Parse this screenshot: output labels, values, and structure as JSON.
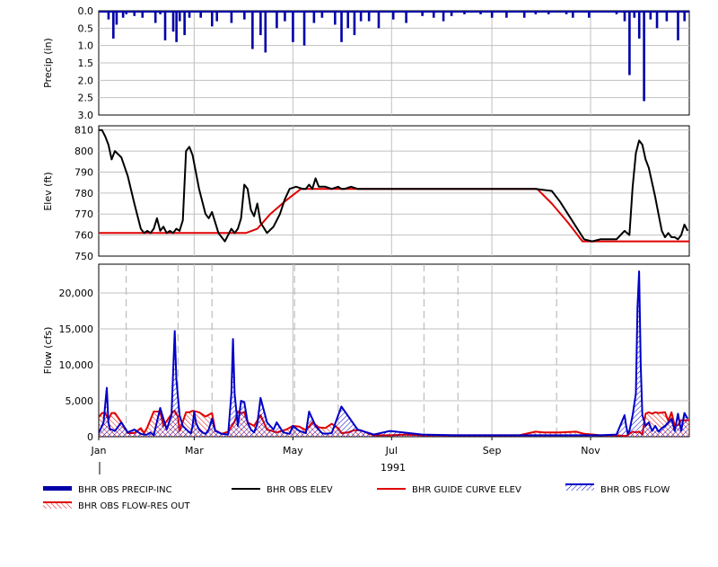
{
  "chart_data": [
    {
      "type": "bar",
      "panel": "precip",
      "series": [
        {
          "name": "BHR OBS PRECIP-INC",
          "color": "#0000a8"
        }
      ],
      "ylabel": "Precip (in)",
      "ylim": [
        0,
        3.0
      ],
      "y_inverted": true,
      "yticks": [
        "0.0",
        "0.5",
        "1.0",
        "1.5",
        "2.0",
        "2.5",
        "3.0"
      ],
      "grid": true,
      "day_of_year": [
        6,
        9,
        11,
        15,
        17,
        22,
        27,
        35,
        38,
        41,
        46,
        48,
        50,
        53,
        56,
        63,
        70,
        73,
        82,
        90,
        95,
        100,
        103,
        110,
        115,
        120,
        127,
        133,
        138,
        146,
        150,
        154,
        158,
        162,
        167,
        173,
        182,
        190,
        200,
        207,
        213,
        218,
        226,
        236,
        243,
        252,
        263,
        270,
        278,
        289,
        293,
        303,
        320,
        325,
        328,
        331,
        334,
        337,
        341,
        345,
        351,
        358,
        362
      ],
      "values": [
        0.25,
        0.8,
        0.4,
        0.2,
        0.1,
        0.15,
        0.2,
        0.35,
        0.1,
        0.85,
        0.6,
        0.9,
        0.3,
        0.7,
        0.2,
        0.2,
        0.45,
        0.3,
        0.35,
        0.25,
        1.1,
        0.7,
        1.2,
        0.5,
        0.3,
        0.9,
        1.0,
        0.35,
        0.2,
        0.4,
        0.9,
        0.5,
        0.7,
        0.3,
        0.3,
        0.5,
        0.25,
        0.35,
        0.15,
        0.2,
        0.3,
        0.15,
        0.1,
        0.1,
        0.2,
        0.2,
        0.2,
        0.1,
        0.1,
        0.1,
        0.2,
        0.2,
        0.1,
        0.3,
        1.85,
        0.2,
        0.8,
        2.6,
        0.25,
        0.5,
        0.3,
        0.85,
        0.3
      ],
      "dense_top": [
        0,
        365
      ]
    },
    {
      "type": "line",
      "panel": "elev",
      "ylabel": "Elev (ft)",
      "ylim": [
        750,
        812
      ],
      "yticks": [
        750,
        760,
        770,
        780,
        790,
        800,
        810
      ],
      "grid": true,
      "series": [
        {
          "name": "BHR OBS ELEV",
          "color": "#000000",
          "x": [
            0,
            2,
            4,
            6,
            8,
            10,
            14,
            18,
            22,
            26,
            28,
            30,
            32,
            34,
            36,
            38,
            40,
            42,
            44,
            46,
            48,
            50,
            52,
            54,
            56,
            58,
            60,
            62,
            64,
            66,
            68,
            70,
            72,
            74,
            76,
            78,
            80,
            82,
            84,
            86,
            88,
            90,
            92,
            94,
            96,
            98,
            100,
            104,
            108,
            112,
            115,
            118,
            122,
            126,
            128,
            130,
            132,
            134,
            136,
            140,
            144,
            148,
            150,
            152,
            156,
            160,
            170,
            180,
            200,
            220,
            240,
            260,
            270,
            280,
            285,
            290,
            295,
            300,
            305,
            310,
            315,
            320,
            325,
            328,
            330,
            332,
            334,
            336,
            338,
            340,
            342,
            344,
            346,
            348,
            350,
            352,
            354,
            356,
            358,
            360,
            362,
            364
          ],
          "y": [
            810,
            810,
            807,
            803,
            796,
            800,
            797,
            788,
            775,
            763,
            761,
            762,
            761,
            763,
            768,
            762,
            764,
            761,
            762,
            761,
            763,
            762,
            767,
            800,
            802,
            798,
            790,
            782,
            776,
            770,
            768,
            771,
            766,
            761,
            759,
            757,
            760,
            763,
            761,
            763,
            768,
            784,
            782,
            772,
            769,
            775,
            766,
            761,
            764,
            770,
            777,
            782,
            783,
            782,
            782,
            784,
            782,
            787,
            783,
            783,
            782,
            783,
            782,
            782,
            783,
            782,
            782,
            782,
            782,
            782,
            782,
            782,
            782,
            781,
            776,
            770,
            764,
            758,
            757,
            758,
            758,
            758,
            762,
            760,
            783,
            799,
            805,
            803,
            796,
            792,
            785,
            778,
            770,
            762,
            759,
            761,
            759,
            759,
            758,
            760,
            765,
            762
          ]
        },
        {
          "name": "BHR GUIDE CURVE ELEV",
          "color": "#e00000",
          "x": [
            0,
            91,
            98,
            106,
            115,
            125,
            150,
            200,
            250,
            271,
            280,
            290,
            299,
            365
          ],
          "y": [
            761,
            761,
            763,
            770,
            776,
            782,
            782,
            782,
            782,
            782,
            775,
            766,
            757,
            757
          ]
        }
      ]
    },
    {
      "type": "area",
      "panel": "flow",
      "ylabel": "Flow (cfs)",
      "ylim": [
        0,
        24000
      ],
      "yticks": [
        "0",
        "5,000",
        "10,000",
        "15,000",
        "20,000"
      ],
      "ytick_values": [
        0,
        5000,
        10000,
        15000,
        20000
      ],
      "grid": true,
      "x_ticks": [
        "Jan",
        "Mar",
        "May",
        "Jul",
        "Sep",
        "Nov"
      ],
      "x_tick_days": [
        0,
        59,
        120,
        181,
        243,
        304
      ],
      "x_sub_label": "1991",
      "series": [
        {
          "name": "BHR OBS FLOW",
          "color": "#0000c8",
          "x": [
            0,
            3,
            5,
            6,
            7,
            8,
            10,
            14,
            18,
            22,
            26,
            28,
            30,
            32,
            34,
            38,
            42,
            45,
            46,
            47,
            48,
            50,
            52,
            55,
            57,
            58,
            59,
            60,
            62,
            64,
            66,
            68,
            70,
            72,
            76,
            80,
            82,
            83,
            84,
            86,
            88,
            90,
            92,
            94,
            96,
            98,
            100,
            104,
            106,
            108,
            110,
            114,
            118,
            120,
            124,
            128,
            130,
            134,
            136,
            138,
            140,
            144,
            150,
            160,
            170,
            180,
            200,
            220,
            240,
            260,
            280,
            300,
            310,
            320,
            325,
            326,
            327,
            328,
            330,
            332,
            333,
            334,
            335,
            336,
            338,
            340,
            342,
            344,
            346,
            348,
            350,
            354,
            356,
            358,
            360,
            362,
            364
          ],
          "y": [
            500,
            2000,
            6800,
            2000,
            1000,
            1000,
            800,
            2000,
            600,
            1000,
            400,
            300,
            300,
            600,
            200,
            4000,
            1000,
            3000,
            9000,
            14700,
            8000,
            3000,
            1500,
            800,
            500,
            1500,
            3500,
            2000,
            1000,
            600,
            400,
            1000,
            2500,
            800,
            400,
            300,
            6000,
            13600,
            6000,
            1500,
            5000,
            4800,
            2000,
            1000,
            600,
            1800,
            5400,
            2000,
            1500,
            1000,
            2000,
            600,
            400,
            1500,
            800,
            500,
            3500,
            1500,
            1000,
            500,
            400,
            500,
            4200,
            1000,
            300,
            800,
            300,
            200,
            200,
            200,
            200,
            200,
            200,
            300,
            3000,
            1500,
            400,
            800,
            3000,
            6000,
            18000,
            23000,
            10000,
            3000,
            1500,
            2000,
            800,
            1500,
            700,
            1200,
            1500,
            2500,
            800,
            3200,
            800,
            3300,
            2500
          ]
        },
        {
          "name": "BHR OBS FLOW-RES OUT",
          "color": "#e00000",
          "x": [
            0,
            2,
            4,
            6,
            8,
            10,
            14,
            18,
            22,
            26,
            28,
            30,
            34,
            38,
            40,
            46,
            47,
            49,
            50,
            54,
            56,
            58,
            62,
            66,
            70,
            72,
            76,
            80,
            84,
            86,
            88,
            90,
            92,
            96,
            100,
            104,
            110,
            116,
            120,
            124,
            128,
            132,
            136,
            140,
            144,
            148,
            150,
            154,
            158,
            162,
            166,
            170,
            180,
            190,
            200,
            220,
            240,
            260,
            270,
            275,
            285,
            295,
            300,
            310,
            320,
            326,
            328,
            330,
            332,
            334,
            336,
            338,
            340,
            342,
            344,
            346,
            350,
            352,
            354,
            356,
            358,
            360,
            362,
            365
          ],
          "y": [
            2700,
            3300,
            3300,
            2400,
            3300,
            3300,
            2000,
            500,
            500,
            1200,
            500,
            1300,
            3500,
            3500,
            1500,
            3500,
            3600,
            2800,
            800,
            3400,
            3400,
            3600,
            3400,
            2800,
            3300,
            900,
            400,
            700,
            2100,
            3500,
            3300,
            3400,
            2000,
            1500,
            3000,
            1000,
            600,
            1000,
            1500,
            1400,
            900,
            2000,
            1300,
            1200,
            1800,
            1200,
            500,
            600,
            900,
            900,
            500,
            200,
            200,
            300,
            200,
            200,
            200,
            200,
            700,
            600,
            600,
            700,
            400,
            200,
            200,
            100,
            400,
            700,
            600,
            700,
            300,
            3200,
            3400,
            3200,
            3400,
            3300,
            3400,
            2200,
            3400,
            1500,
            1600,
            2300,
            2300,
            2300
          ]
        }
      ],
      "vlines_day": [
        17,
        49,
        70,
        121,
        148,
        201,
        222,
        283
      ]
    }
  ],
  "legend": {
    "items": [
      {
        "label": "BHR OBS PRECIP-INC",
        "style": "thick-bar",
        "color": "#0000a8"
      },
      {
        "label": "BHR OBS ELEV",
        "style": "line",
        "color": "#000000"
      },
      {
        "label": "BHR GUIDE CURVE ELEV",
        "style": "line",
        "color": "#e00000"
      },
      {
        "label": "BHR OBS FLOW",
        "style": "hatch",
        "color": "#0000c8"
      },
      {
        "label": "BHR OBS FLOW-RES OUT",
        "style": "hatch",
        "color": "#e00000"
      }
    ]
  }
}
